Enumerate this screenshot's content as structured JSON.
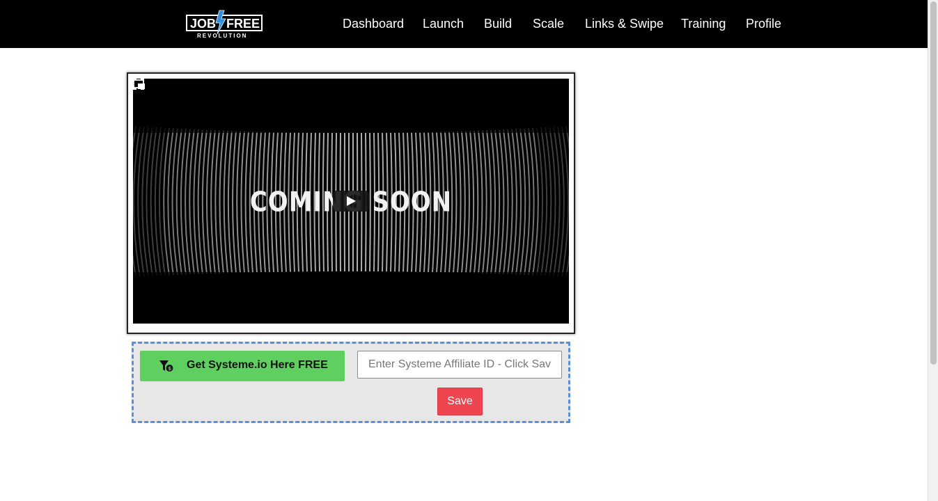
{
  "header": {
    "logo": {
      "line1_left": "JOB",
      "line1_right": "FREE",
      "line2": "REVOLUTION"
    },
    "nav": [
      {
        "id": "dashboard",
        "label": "Dashboard"
      },
      {
        "id": "launch",
        "label": "Launch"
      },
      {
        "id": "build",
        "label": "Build"
      },
      {
        "id": "scale",
        "label": "Scale"
      },
      {
        "id": "links-swipe",
        "label": "Links & Swipe"
      },
      {
        "id": "training",
        "label": "Training"
      },
      {
        "id": "profile",
        "label": "Profile"
      }
    ]
  },
  "video": {
    "overlay_text": "COMING SOON",
    "icons": {
      "play": "play-icon",
      "pip": "picture-in-picture-icon",
      "fullscreen": "fullscreen-icon"
    }
  },
  "form": {
    "cta_label": "Get Systeme.io Here FREE",
    "cta_icon": "funnel-dollar-icon",
    "affiliate_input": {
      "value": "",
      "placeholder": "Enter Systeme Affiliate ID - Click Save"
    },
    "save_label": "Save"
  },
  "colors": {
    "header_bg": "#000000",
    "cta_green": "#5fd05f",
    "save_red": "#ee4550",
    "panel_bg": "#e8e7e8",
    "panel_border": "#5b8fd6",
    "logo_blue": "#2e8fe6"
  }
}
